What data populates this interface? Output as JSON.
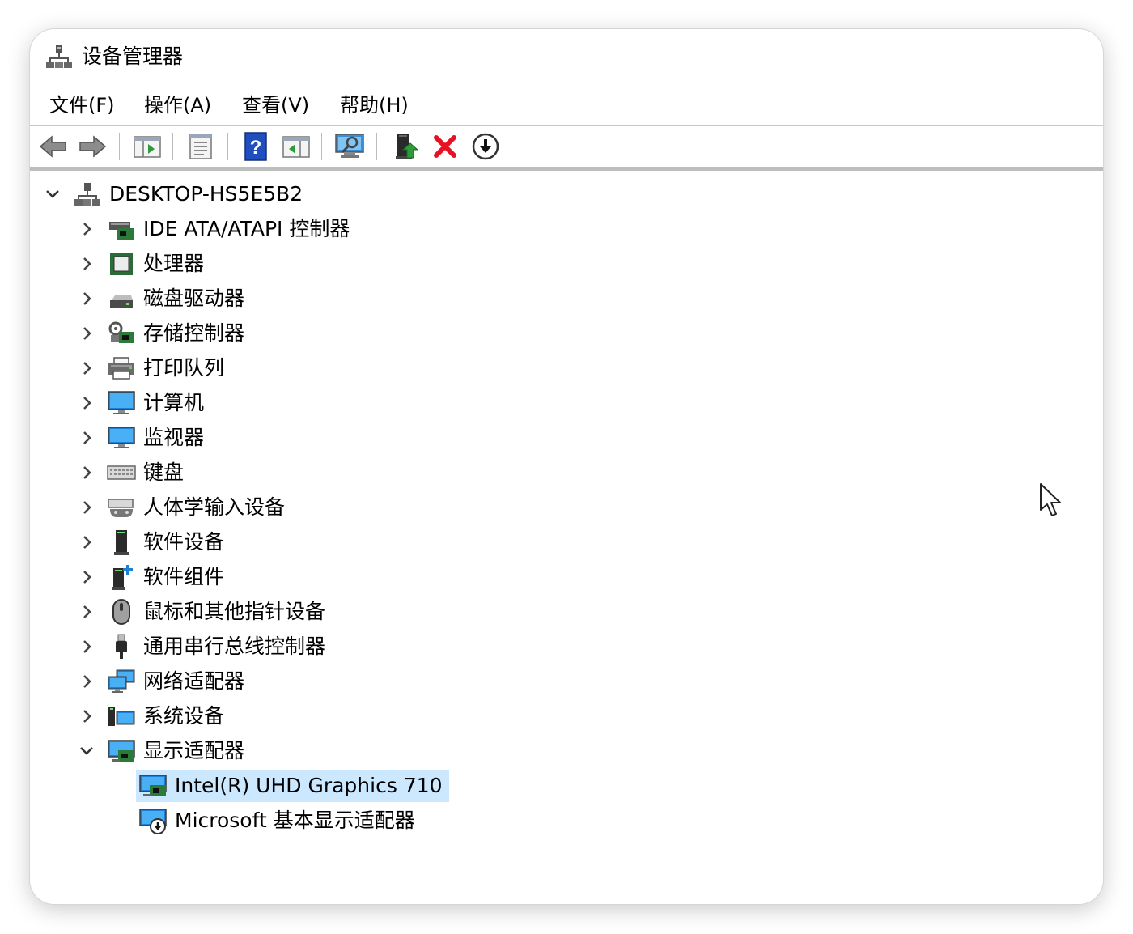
{
  "window": {
    "title": "设备管理器",
    "icon": "device-manager-icon"
  },
  "menu": [
    "文件(F)",
    "操作(A)",
    "查看(V)",
    "帮助(H)"
  ],
  "toolbar": {
    "buttons": [
      "back-arrow-icon",
      "forward-arrow-icon",
      "show-hide-console-tree-icon",
      "properties-icon",
      "help-icon",
      "action-pane-icon",
      "scan-hardware-icon",
      "update-driver-icon",
      "uninstall-device-icon",
      "disable-device-icon"
    ]
  },
  "tree": {
    "root": "DESKTOP-HS5E5B2",
    "categories": [
      {
        "label": "IDE ATA/ATAPI 控制器",
        "icon": "ide-controller-icon",
        "expanded": false
      },
      {
        "label": "处理器",
        "icon": "processor-icon",
        "expanded": false
      },
      {
        "label": "磁盘驱动器",
        "icon": "disk-drive-icon",
        "expanded": false
      },
      {
        "label": "存储控制器",
        "icon": "storage-controller-icon",
        "expanded": false
      },
      {
        "label": "打印队列",
        "icon": "printer-icon",
        "expanded": false
      },
      {
        "label": "计算机",
        "icon": "computer-icon",
        "expanded": false
      },
      {
        "label": "监视器",
        "icon": "monitor-icon",
        "expanded": false
      },
      {
        "label": "键盘",
        "icon": "keyboard-icon",
        "expanded": false
      },
      {
        "label": "人体学输入设备",
        "icon": "hid-icon",
        "expanded": false
      },
      {
        "label": "软件设备",
        "icon": "software-device-icon",
        "expanded": false
      },
      {
        "label": "软件组件",
        "icon": "software-component-icon",
        "expanded": false
      },
      {
        "label": "鼠标和其他指针设备",
        "icon": "mouse-icon",
        "expanded": false
      },
      {
        "label": "通用串行总线控制器",
        "icon": "usb-icon",
        "expanded": false
      },
      {
        "label": "网络适配器",
        "icon": "network-adapter-icon",
        "expanded": false
      },
      {
        "label": "系统设备",
        "icon": "system-device-icon",
        "expanded": false
      },
      {
        "label": "显示适配器",
        "icon": "display-adapter-icon",
        "expanded": true
      }
    ],
    "display_children": [
      {
        "label": "Intel(R) UHD Graphics 710",
        "icon": "display-adapter-icon",
        "selected": true
      },
      {
        "label": "Microsoft 基本显示适配器",
        "icon": "display-adapter-disabled-icon",
        "selected": false
      }
    ]
  },
  "colors": {
    "selection": "#cce8ff",
    "uninstall_red": "#e81123",
    "help_blue": "#1f4fbf"
  }
}
